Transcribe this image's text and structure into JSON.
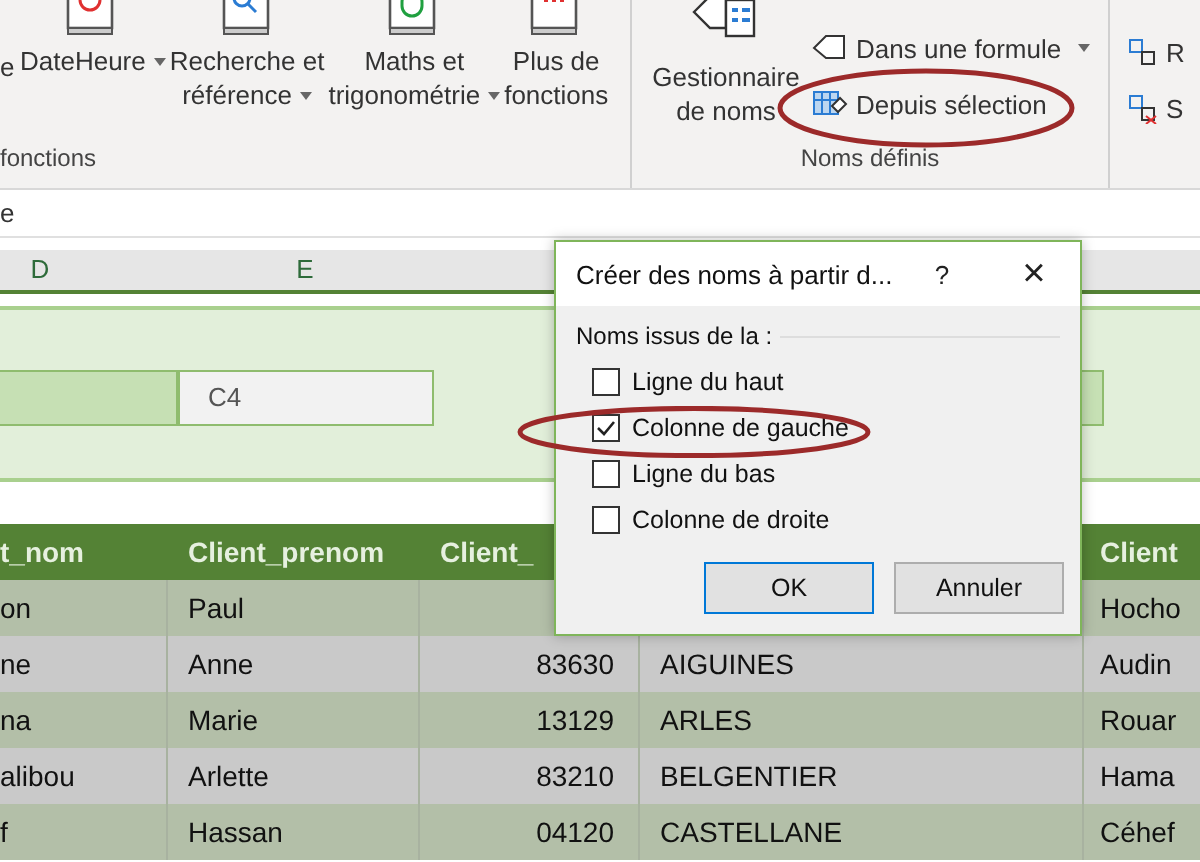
{
  "ribbon": {
    "cut_left_label": "e",
    "function_buttons": [
      {
        "lines": [
          "DateHeure"
        ],
        "caret": true
      },
      {
        "lines": [
          "Recherche et",
          "référence"
        ],
        "caret": true
      },
      {
        "lines": [
          "Maths et",
          "trigonométrie"
        ],
        "caret": true
      },
      {
        "lines": [
          "Plus de",
          "fonctions"
        ],
        "caret": false
      }
    ],
    "function_group_label": "fonctions",
    "name_manager": [
      "Gestionnaire",
      "de noms"
    ],
    "name_commands": [
      {
        "label": "Dans une formule",
        "caret": true
      },
      {
        "label": "Depuis sélection",
        "caret": false
      }
    ],
    "names_group_label": "Noms définis",
    "audit_commands": [
      "R",
      "S"
    ]
  },
  "formula_bar": {
    "value": "e"
  },
  "column_headers": [
    "D",
    "E"
  ],
  "panel": {
    "field_value": "C4"
  },
  "table": {
    "columns": [
      "t_nom",
      "Client_prenom",
      "Client_",
      null,
      "Client"
    ],
    "rows": [
      {
        "cells": [
          "on",
          "Paul",
          null,
          null,
          "Hocho"
        ]
      },
      {
        "cells": [
          "ne",
          "Anne",
          "83630",
          "AIGUINES",
          "Audin"
        ]
      },
      {
        "cells": [
          "na",
          "Marie",
          "13129",
          "ARLES",
          "Rouar"
        ]
      },
      {
        "cells": [
          "alibou",
          "Arlette",
          "83210",
          "BELGENTIER",
          "Hama"
        ]
      },
      {
        "cells": [
          "f",
          "Hassan",
          "04120",
          "CASTELLANE",
          "Céhef"
        ]
      }
    ]
  },
  "dialog": {
    "title": "Créer des noms à partir d...",
    "help": "?",
    "close": "×",
    "group_label": "Noms issus de la :",
    "options": [
      {
        "label": "Ligne du haut",
        "checked": false
      },
      {
        "label": "Colonne de gauche",
        "checked": true
      },
      {
        "label": "Ligne du bas",
        "checked": false
      },
      {
        "label": "Colonne de droite",
        "checked": false
      }
    ],
    "buttons": [
      {
        "label": "OK",
        "default": true
      },
      {
        "label": "Annuler",
        "default": false
      }
    ]
  }
}
